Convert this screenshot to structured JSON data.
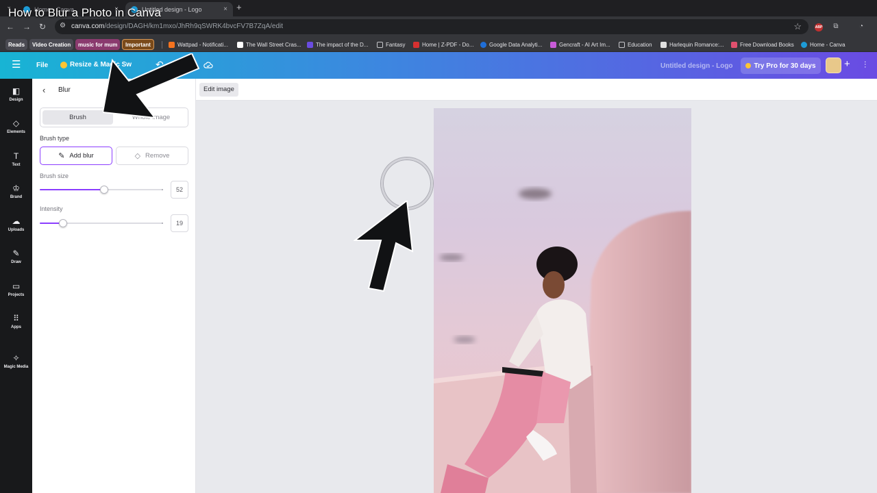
{
  "video_title": "How to Blur a Photo in Canva",
  "browser": {
    "tabs": [
      {
        "label": "Home - Canva",
        "active": false
      },
      {
        "label": "Untitled design - Logo",
        "active": true
      }
    ],
    "new_tab_glyph": "+",
    "close_glyph": "×",
    "url_host": "canva.com",
    "url_path": "/design/DAGH/km1mxo/JhRh9qSWRK4bvcFV7B7ZqA/edit",
    "bookmarks": [
      {
        "label": "Reads",
        "kind": "chip",
        "color": "#4a4a52"
      },
      {
        "label": "Video Creation",
        "kind": "chip",
        "color": "#4a4a52"
      },
      {
        "label": "music for mum",
        "kind": "chip",
        "color": "#8a3a6e"
      },
      {
        "label": "Important",
        "kind": "chip",
        "color": "#7a4a1a"
      },
      {
        "label": "Wattpad - Notificati...",
        "kind": "link",
        "icon_color": "#f5731e"
      },
      {
        "label": "The Wall Street Cras...",
        "kind": "link",
        "icon_color": "#000000"
      },
      {
        "label": "The impact of the D...",
        "kind": "link",
        "icon_color": "#6a4ce0"
      },
      {
        "label": "Fantasy",
        "kind": "folder",
        "icon_color": "#c8c8cc"
      },
      {
        "label": "Home | Z-PDF - Do...",
        "kind": "link",
        "icon_color": "#d63030"
      },
      {
        "label": "Google Data Analyti...",
        "kind": "link",
        "icon_color": "#1f6ed8"
      },
      {
        "label": "Gencraft - AI Art Im...",
        "kind": "link",
        "icon_color": "#c85bd8"
      },
      {
        "label": "Education",
        "kind": "folder",
        "icon_color": "#c8c8cc"
      },
      {
        "label": "Harlequin Romance:...",
        "kind": "link",
        "icon_color": "#e0e0e0"
      },
      {
        "label": "Free Download Books",
        "kind": "link",
        "icon_color": "#e0506e"
      },
      {
        "label": "Home - Canva",
        "kind": "link",
        "icon_color": "#1d9bd6"
      }
    ]
  },
  "canva": {
    "file_label": "File",
    "resize_label": "Resize & Magic Sw",
    "design_title": "Untitled design - Logo",
    "try_pro_label": "Try Pro for 30 days",
    "accent": "#8b3dff",
    "rail": [
      {
        "label": "Design",
        "icon": "design-icon",
        "glyph": "◧"
      },
      {
        "label": "Elements",
        "icon": "elements-icon",
        "glyph": "◇"
      },
      {
        "label": "Text",
        "icon": "text-icon",
        "glyph": "T"
      },
      {
        "label": "Brand",
        "icon": "brand-icon",
        "glyph": "♔"
      },
      {
        "label": "Uploads",
        "icon": "uploads-icon",
        "glyph": "☁"
      },
      {
        "label": "Draw",
        "icon": "draw-icon",
        "glyph": "✎"
      },
      {
        "label": "Projects",
        "icon": "projects-icon",
        "glyph": "▭"
      },
      {
        "label": "Apps",
        "icon": "apps-icon",
        "glyph": "⠿"
      },
      {
        "label": "Magic Media",
        "icon": "magic-media-icon",
        "glyph": "✧"
      }
    ]
  },
  "panel": {
    "title": "Blur",
    "mode_brush": "Brush",
    "mode_whole": "Whole image",
    "brush_type_label": "Brush type",
    "add_blur_label": "Add blur",
    "remove_label": "Remove",
    "brush_size_label": "Brush size",
    "brush_size_value": "52",
    "brush_size_fraction": 0.52,
    "intensity_label": "Intensity",
    "intensity_value": "19",
    "intensity_fraction": 0.19
  },
  "workspace": {
    "edit_image_label": "Edit image"
  }
}
